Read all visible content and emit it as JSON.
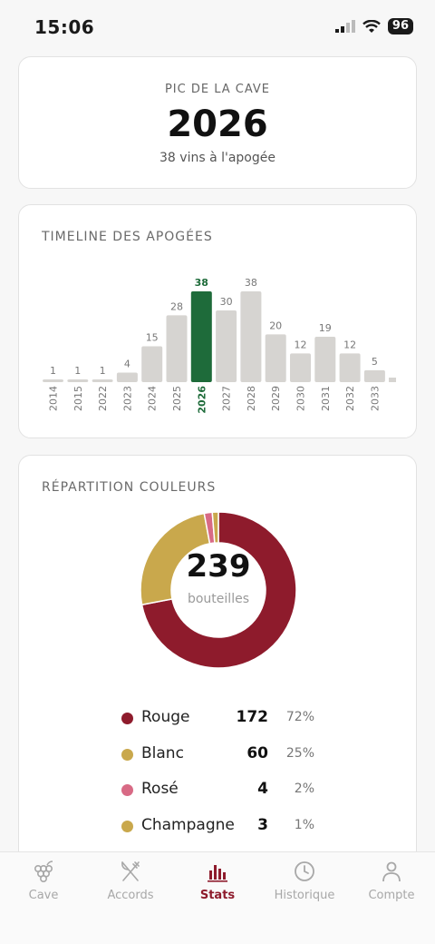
{
  "status_bar": {
    "time": "15:06",
    "battery": "96"
  },
  "peak": {
    "label": "PIC DE LA CAVE",
    "year": "2026",
    "subtitle": "38 vins à l'apogée"
  },
  "timeline": {
    "title": "TIMELINE DES APOGÉES",
    "highlight_color": "#1e6b3a",
    "bar_color": "#d6d4d1",
    "chart_data": {
      "type": "bar",
      "categories": [
        "2014",
        "2015",
        "2022",
        "2023",
        "2024",
        "2025",
        "2026",
        "2027",
        "2028",
        "2029",
        "2030",
        "2031",
        "2032",
        "2033"
      ],
      "values": [
        1,
        1,
        1,
        4,
        15,
        28,
        38,
        30,
        38,
        20,
        12,
        19,
        12,
        5
      ],
      "highlight": "2026"
    }
  },
  "colors": {
    "title": "RÉPARTITION COULEURS",
    "total": "239",
    "unit": "bouteilles",
    "chart_data": {
      "type": "pie",
      "categories": [
        "Rouge",
        "Blanc",
        "Rosé",
        "Champagne"
      ],
      "values": [
        172,
        60,
        4,
        3
      ],
      "percent": [
        "72%",
        "25%",
        "2%",
        "1%"
      ],
      "colors": [
        "#8e1b2c",
        "#c9a84c",
        "#d86a85",
        "#c9a84c"
      ]
    }
  },
  "tabs": [
    {
      "label": "Cave",
      "icon": "grapes-icon",
      "active": false
    },
    {
      "label": "Accords",
      "icon": "utensils-icon",
      "active": false
    },
    {
      "label": "Stats",
      "icon": "bar-chart-icon",
      "active": true
    },
    {
      "label": "Historique",
      "icon": "clock-icon",
      "active": false
    },
    {
      "label": "Compte",
      "icon": "user-icon",
      "active": false
    }
  ],
  "theme": {
    "accent": "#8e1b2c"
  }
}
